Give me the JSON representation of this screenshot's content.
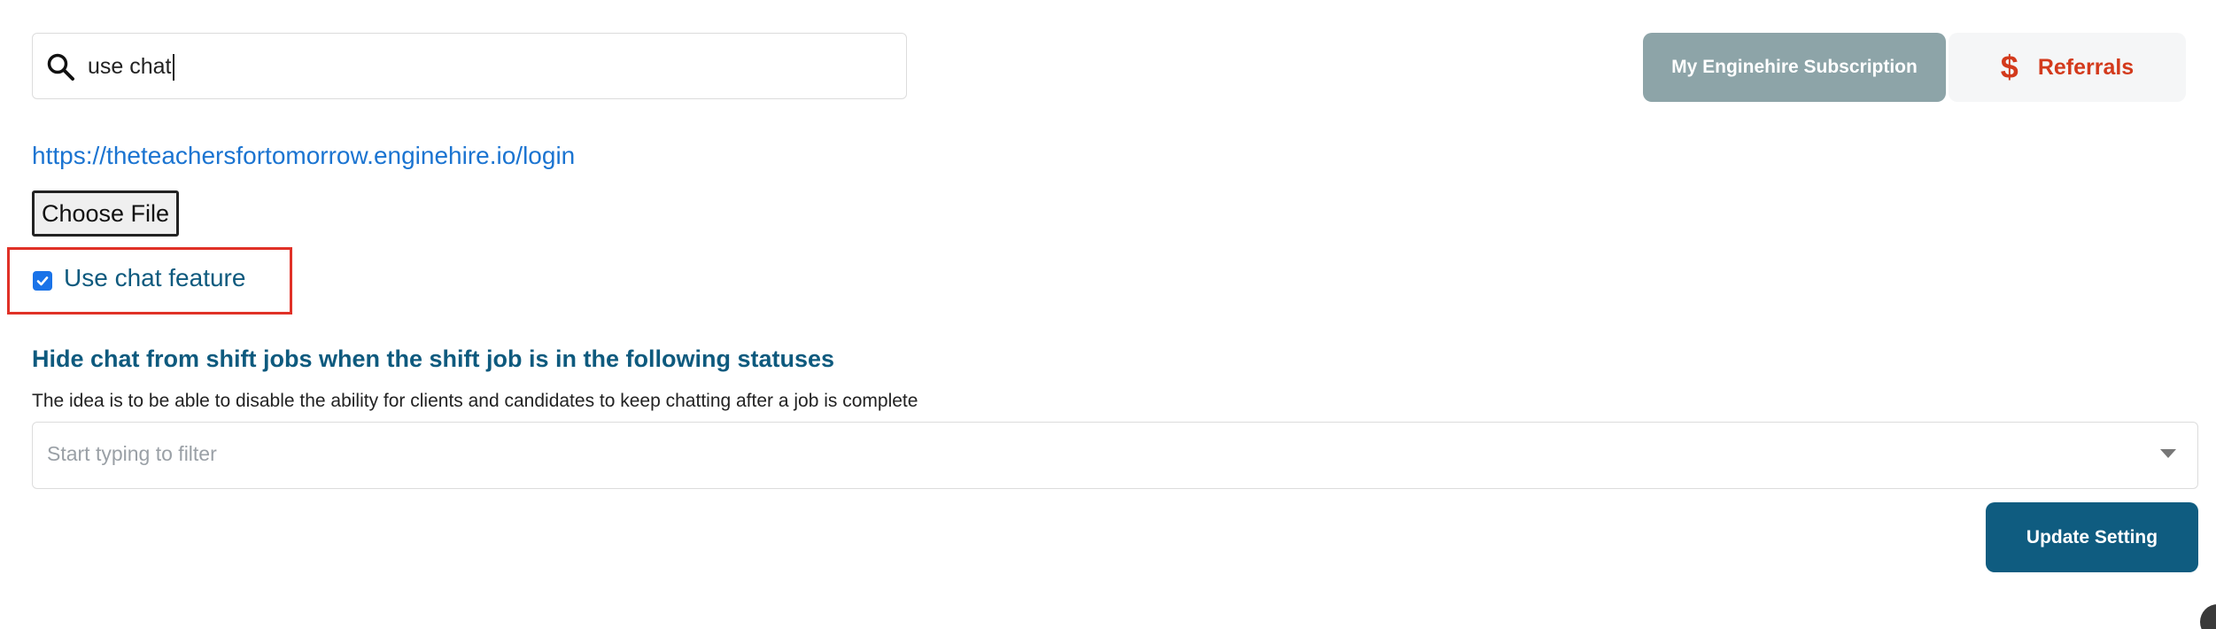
{
  "search": {
    "value": "use chat",
    "icon": "search-icon"
  },
  "header": {
    "subscription_label": "My Enginehire Subscription",
    "referrals_label": "Referrals",
    "referrals_icon": "dollar-icon",
    "colors": {
      "subscription_bg": "#8da4a8",
      "referrals_accent": "#d33a1c"
    }
  },
  "settings": {
    "login_url": "https://theteachersfortomorrow.enginehire.io/login",
    "file_button_label": "Choose File",
    "chat_feature": {
      "label": "Use chat feature",
      "checked": true
    },
    "hide_chat": {
      "title": "Hide chat from shift jobs when the shift job is in the following statuses",
      "description": "The idea is to be able to disable the ability for clients and candidates to keep chatting after a job is complete",
      "placeholder": "Start typing to filter"
    },
    "update_label": "Update Setting"
  }
}
